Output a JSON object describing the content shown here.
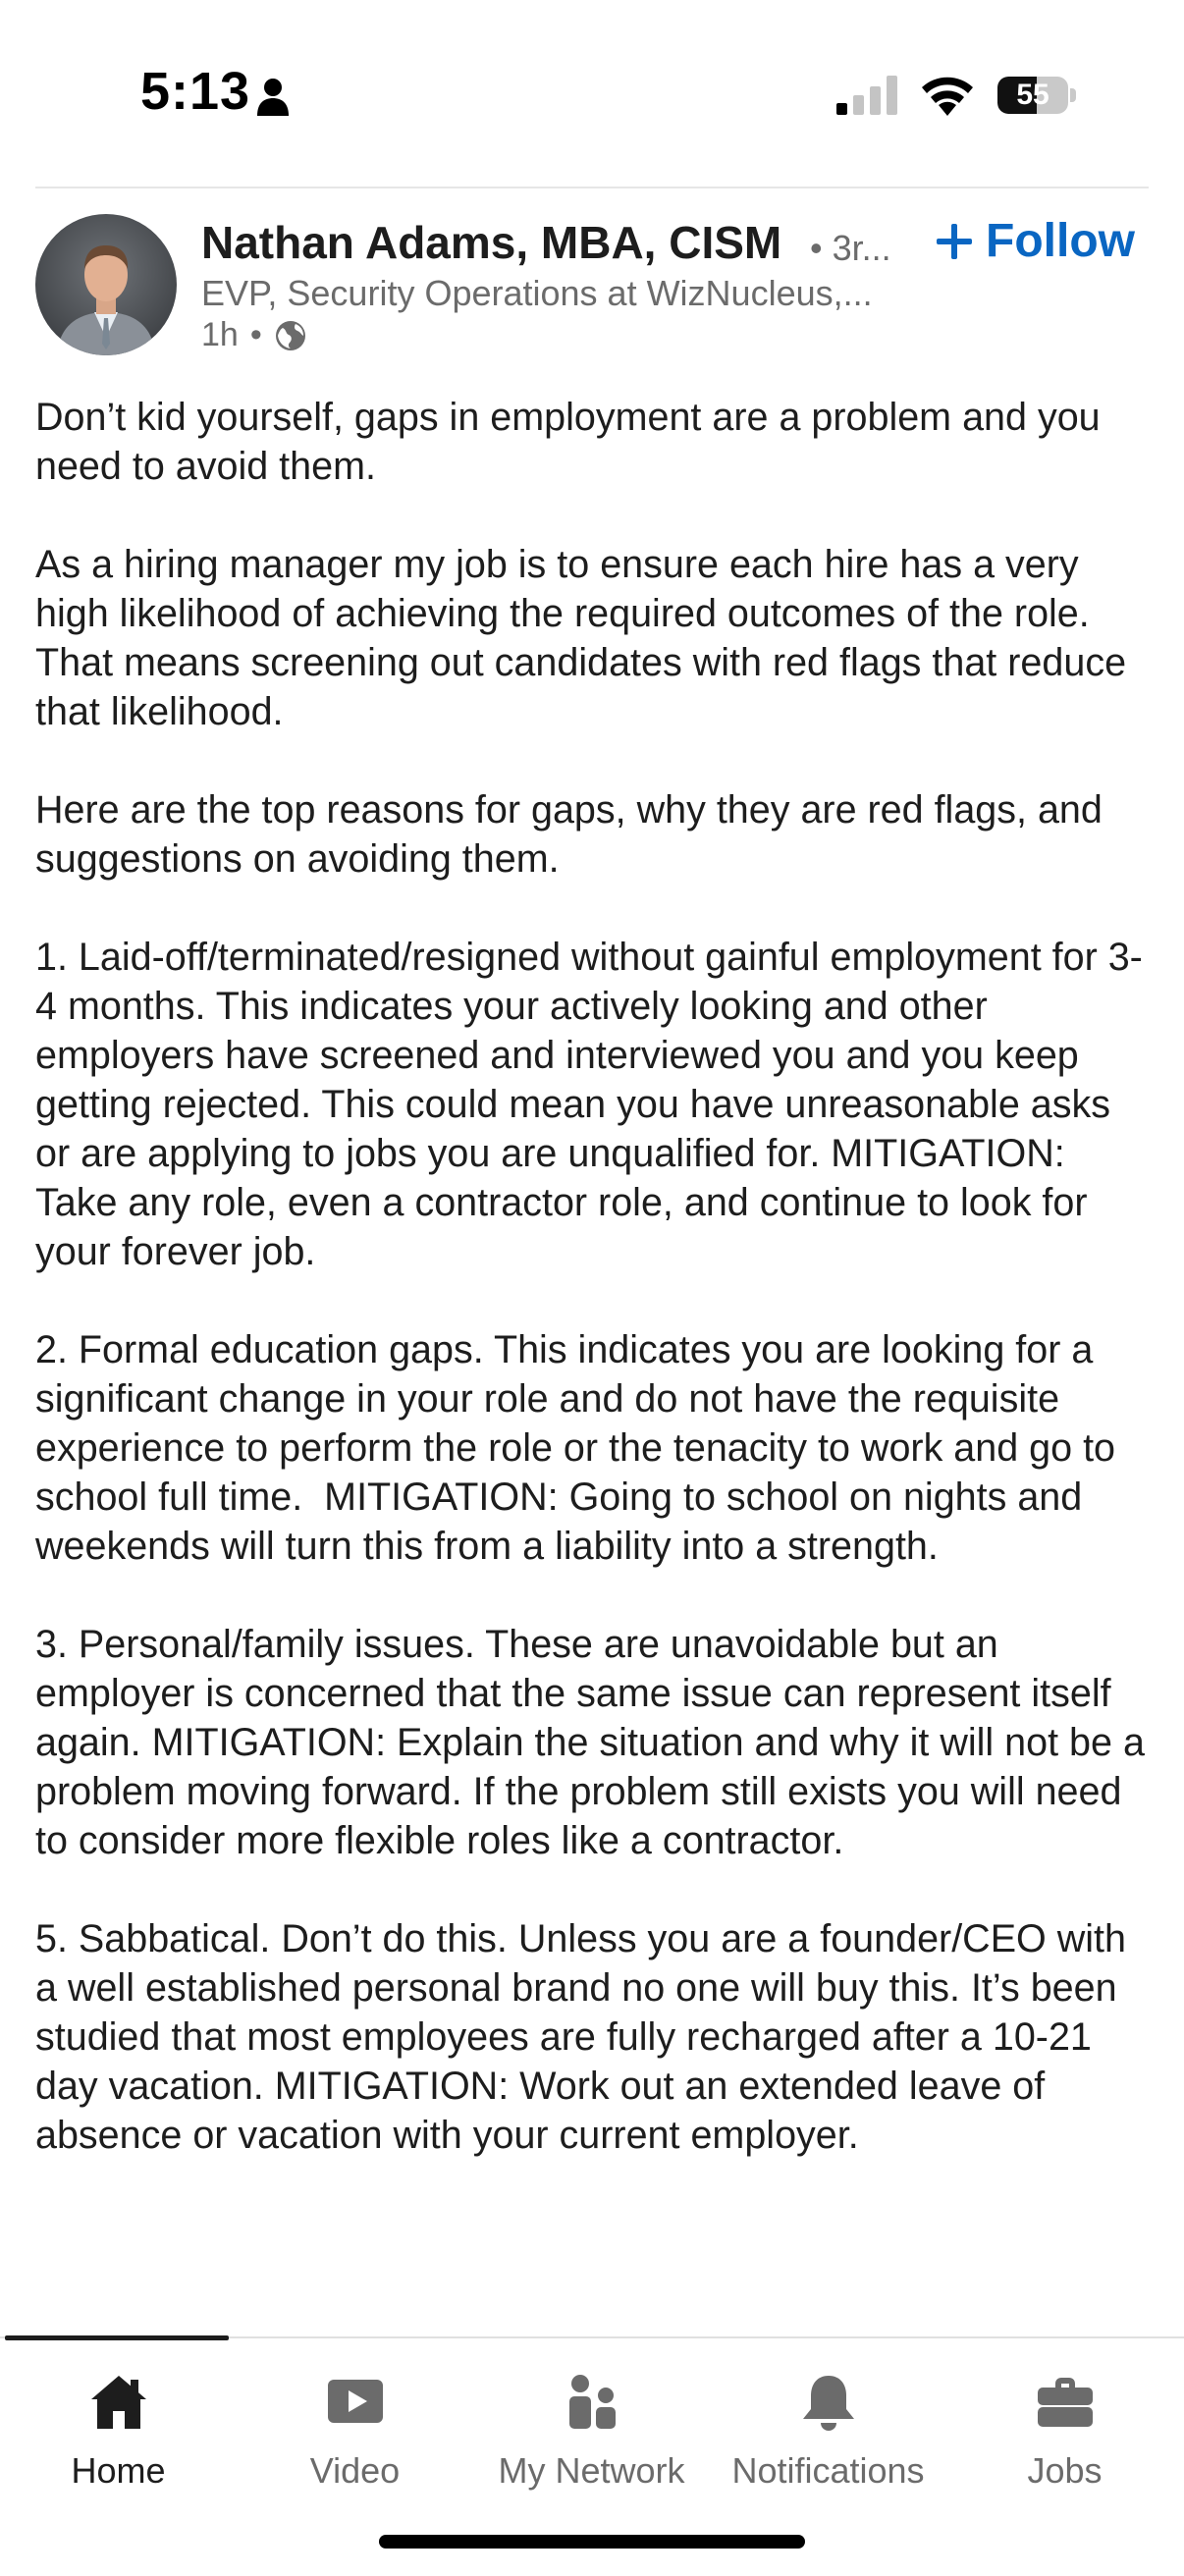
{
  "status_bar": {
    "time": "5:13",
    "battery_level": 55,
    "battery_label": "55"
  },
  "post": {
    "author": {
      "name": "Nathan Adams, MBA, CISM",
      "degree": "• 3r...",
      "headline": "EVP, Security Operations at WizNucleus,...",
      "time_ago": "1h",
      "separator": "•",
      "visibility_icon": "globe-icon"
    },
    "follow_label": "Follow",
    "paragraphs": [
      "Don’t kid yourself, gaps in employment are a problem and you need to avoid them.",
      "As a hiring manager my job is to ensure each hire has a very high likelihood of achieving the required outcomes of the role. That means screening out candidates with red flags that reduce that likelihood.",
      "Here are the top reasons for gaps, why they are red flags, and suggestions on avoiding them.",
      "1. Laid-off/terminated/resigned without gainful employment for 3-4 months. This indicates your actively looking and other employers have screened and interviewed you and you keep getting rejected. This could mean you have unreasonable asks or are applying to jobs you are unqualified for. MITIGATION: Take any role, even a contractor role, and continue to look for your forever job.",
      "2. Formal education gaps. This indicates you are looking for a significant change in your role and do not have the requisite experience to perform the role or the tenacity to work and go to school full time.  MITIGATION: Going to school on nights and weekends will turn this from a liability into a strength.",
      "3. Personal/family issues. These are unavoidable but an employer is concerned that the same issue can represent itself again. MITIGATION: Explain the situation and why it will not be a problem moving forward. If the problem still exists you will need to consider more flexible roles like a contractor.",
      "5. Sabbatical. Don’t do this. Unless you are a founder/CEO with a well established personal brand no one will buy this. It’s been studied that most employees are fully recharged after a 10-21 day vacation. MITIGATION: Work out an extended leave of absence or vacation with your current employer."
    ]
  },
  "bottom_nav": {
    "items": [
      {
        "label": "Home",
        "icon": "home-icon",
        "active": true
      },
      {
        "label": "Video",
        "icon": "video-icon",
        "active": false
      },
      {
        "label": "My Network",
        "icon": "network-icon",
        "active": false
      },
      {
        "label": "Notifications",
        "icon": "bell-icon",
        "active": false
      },
      {
        "label": "Jobs",
        "icon": "briefcase-icon",
        "active": false
      }
    ]
  },
  "colors": {
    "accent": "#0a66c2",
    "text": "#1d1d1d",
    "muted": "#6b6b6b"
  }
}
